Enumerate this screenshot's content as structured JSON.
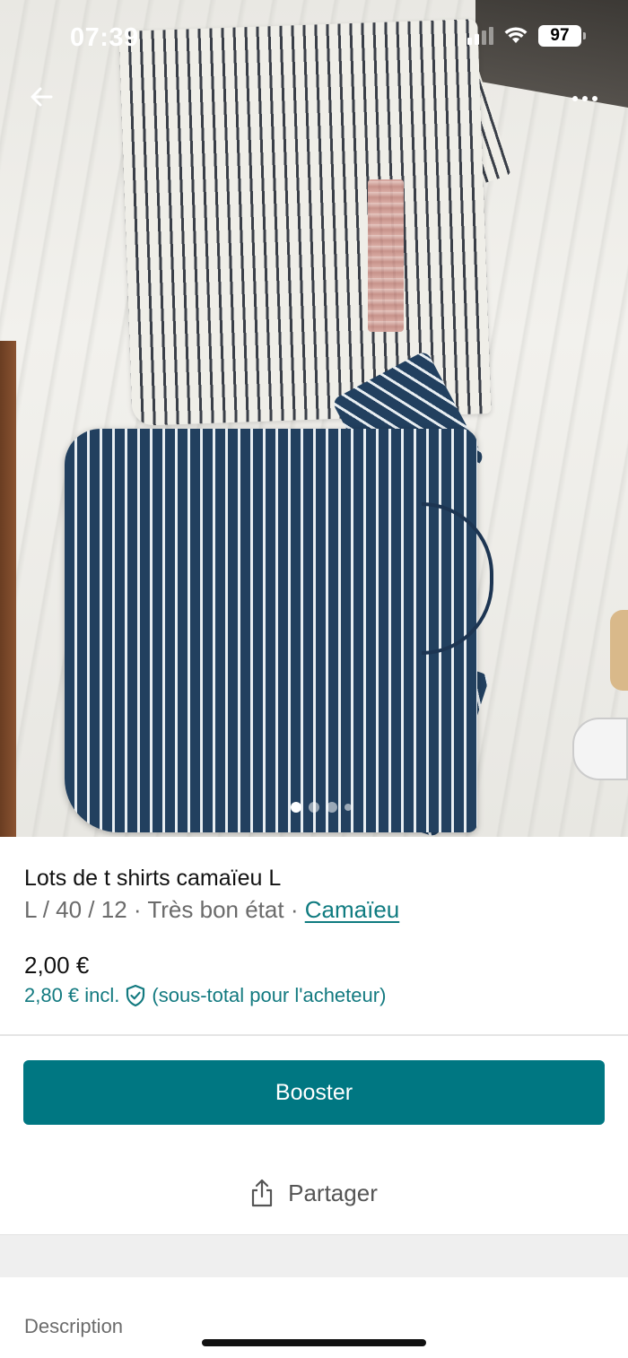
{
  "status_bar": {
    "time": "07:39",
    "battery": "97"
  },
  "photo": {
    "image_count": 4,
    "current_index": 1
  },
  "listing": {
    "title": "Lots de t shirts camaïeu L",
    "size": "L / 40 / 12",
    "separator": "·",
    "condition": "Très bon état",
    "brand": "Camaïeu",
    "price": "2,00 €",
    "buyer_price": "2,80 € incl.",
    "buyer_note": "(sous-total pour l'acheteur)"
  },
  "actions": {
    "booster_label": "Booster",
    "share_label": "Partager"
  },
  "description": {
    "label": "Description"
  },
  "colors": {
    "accent": "#007782",
    "link": "#0f7b80"
  },
  "icons": [
    "back-arrow-icon",
    "more-icon",
    "shield-check-icon",
    "share-icon",
    "wifi-icon",
    "signal-icon",
    "battery-icon"
  ]
}
